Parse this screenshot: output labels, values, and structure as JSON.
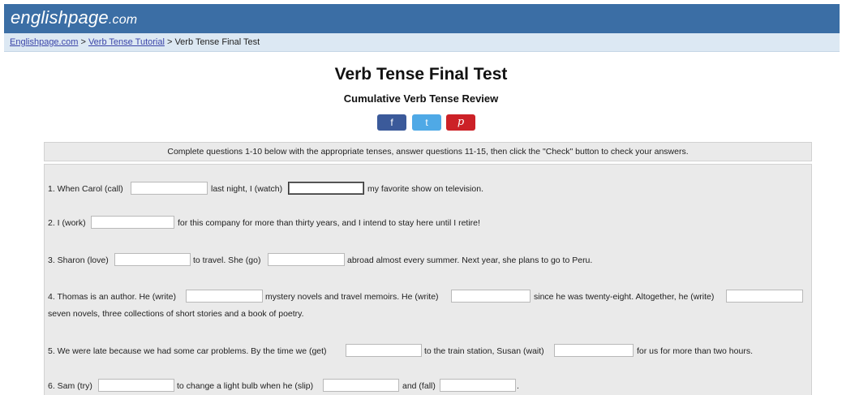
{
  "header": {
    "logo_main": "englishpage",
    "logo_suffix": ".com"
  },
  "breadcrumb": {
    "home": "Englishpage.com",
    "sep1": " > ",
    "tutorial": "Verb Tense Tutorial",
    "sep2": " > ",
    "current": "Verb Tense Final Test"
  },
  "page": {
    "title": "Verb Tense Final Test",
    "subtitle": "Cumulative Verb Tense Review"
  },
  "social": {
    "facebook": "f",
    "twitter": "t",
    "pinterest": "p"
  },
  "instructions": "Complete questions 1-10 below with the appropriate tenses, answer questions 11-15, then click the \"Check\" button to check your answers.",
  "questions": {
    "q1": {
      "part1": "1. When Carol (call)",
      "part2": "last night, I (watch)",
      "part3": "my favorite show on television."
    },
    "q2": {
      "part1": "2. I (work)",
      "part2": "for this company for more than thirty years, and I intend to stay here until I retire!"
    },
    "q3": {
      "part1": "3. Sharon (love)",
      "part2": "to travel. She (go)",
      "part3": "abroad almost every summer. Next year, she plans to go to Peru."
    },
    "q4": {
      "part1": "4. Thomas is an author. He (write)",
      "part2": "mystery novels and travel memoirs. He (write)",
      "part3": "since he was twenty-eight. Altogether, he (write)",
      "part4": "seven novels, three collections of short stories and a book of poetry."
    },
    "q5": {
      "part1": "5. We were late because we had some car problems. By the time we (get)",
      "part2": "to the train station, Susan (wait)",
      "part3": "for us for more than two hours."
    },
    "q6": {
      "part1": "6. Sam (try)",
      "part2": "to change a light bulb when he (slip)",
      "part3": "and (fall)",
      "part4": "."
    }
  }
}
